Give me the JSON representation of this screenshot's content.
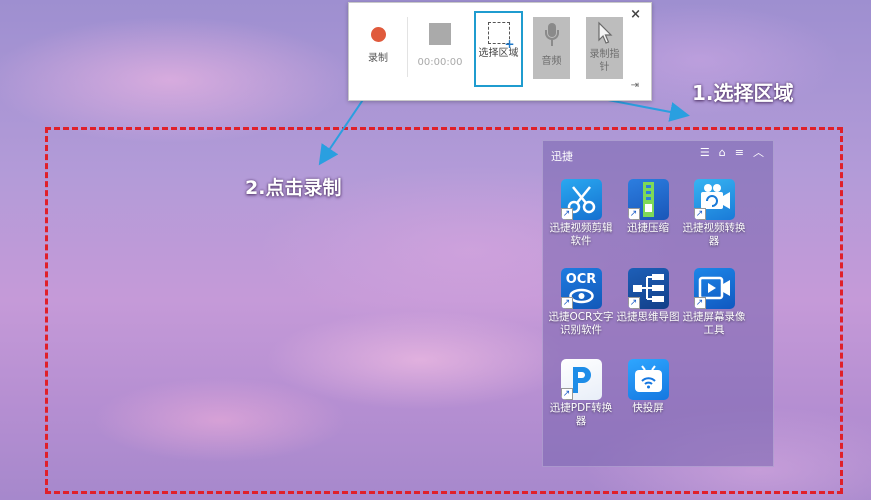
{
  "toolbar": {
    "record_label": "录制",
    "timer": "00:00:00",
    "select_area_label": "选择区域",
    "audio_label": "音频",
    "pointer_label": "录制指针",
    "close_symbol": "×",
    "pin_symbol": "⇥",
    "record_color": "#e05a3c",
    "selected_border_color": "#1f9ccf"
  },
  "annotations": {
    "step1": "1.选择区域",
    "step2": "2.点击录制",
    "region_border_color": "#e0202a",
    "arrow_color": "#2a9fe0"
  },
  "widget": {
    "title": "迅捷",
    "controls": [
      "list-icon",
      "lock-icon",
      "menu-icon",
      "collapse-icon"
    ],
    "apps": [
      {
        "label": "迅捷视频剪辑软件",
        "icon": "scissors-icon"
      },
      {
        "label": "迅捷压缩",
        "icon": "zip-icon"
      },
      {
        "label": "迅捷视频转换器",
        "icon": "video-convert-icon"
      },
      {
        "label": "迅捷OCR文字识别软件",
        "icon": "ocr-icon"
      },
      {
        "label": "迅捷思维导图",
        "icon": "mindmap-icon"
      },
      {
        "label": "迅捷屏幕录像工具",
        "icon": "screen-record-icon"
      },
      {
        "label": "迅捷PDF转换器",
        "icon": "pdf-icon"
      },
      {
        "label": "快投屏",
        "icon": "cast-icon"
      }
    ]
  }
}
